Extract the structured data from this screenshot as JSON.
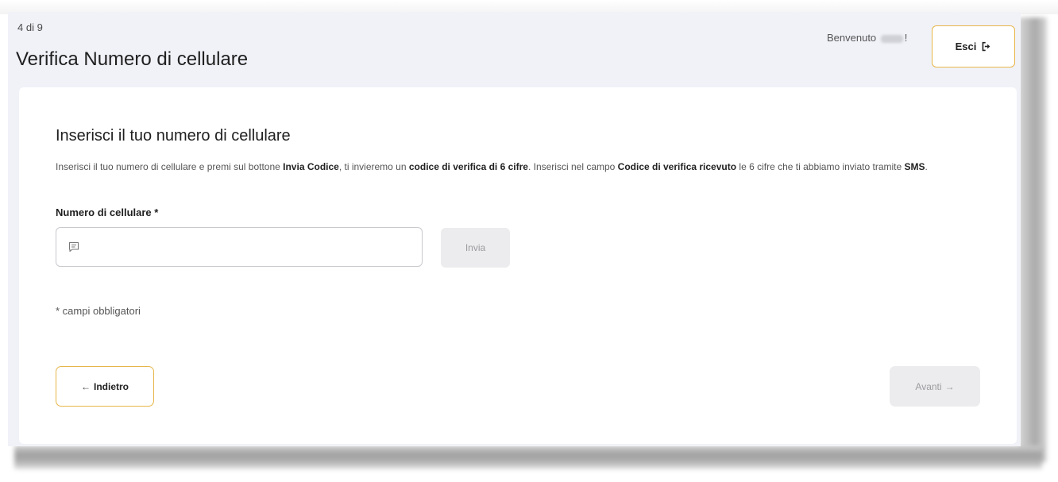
{
  "header": {
    "step_label": "4 di 9",
    "title": "Verifica Numero di cellulare",
    "welcome_prefix": "Benvenuto",
    "welcome_suffix": "!",
    "logout_label": "Esci"
  },
  "form": {
    "section_title": "Inserisci il tuo numero di cellulare",
    "instructions": [
      {
        "text": "Inserisci il tuo numero di cellulare e premi sul bottone ",
        "bold": false
      },
      {
        "text": "Invia Codice",
        "bold": true
      },
      {
        "text": ", ti invieremo un ",
        "bold": false
      },
      {
        "text": "codice di verifica di 6 cifre",
        "bold": true
      },
      {
        "text": ". Inserisci nel campo ",
        "bold": false
      },
      {
        "text": "Codice di verifica ricevuto",
        "bold": true
      },
      {
        "text": " le 6 cifre che ti abbiamo inviato tramite ",
        "bold": false
      },
      {
        "text": "SMS",
        "bold": true
      },
      {
        "text": ".",
        "bold": false
      }
    ],
    "phone_label": "Numero di cellulare *",
    "phone_value": "",
    "send_label": "Invia",
    "required_note": "* campi obbligatori"
  },
  "nav": {
    "back_arrow": "←",
    "back_label": "Indietro",
    "next_label": "Avanti",
    "next_arrow": "→"
  },
  "colors": {
    "accent_border": "#e7b64a",
    "header_bg": "#f1f2f8",
    "disabled_bg": "#ececee"
  }
}
